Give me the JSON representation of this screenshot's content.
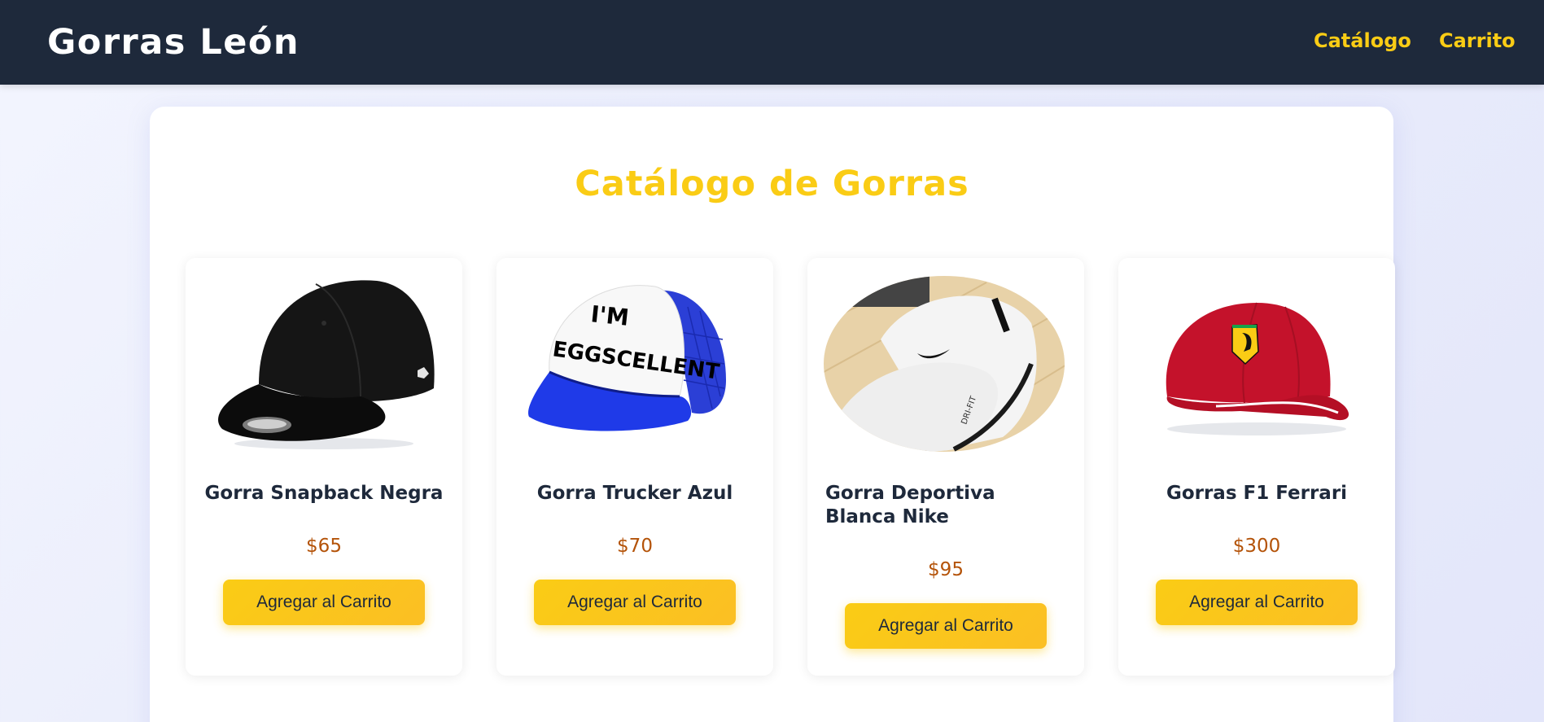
{
  "header": {
    "brand": "Gorras León",
    "nav": [
      {
        "label": "Catálogo"
      },
      {
        "label": "Carrito"
      }
    ]
  },
  "main": {
    "title": "Catálogo de Gorras",
    "products": [
      {
        "name": "Gorra Snapback Negra",
        "price": "$65",
        "button": "Agregar al Carrito",
        "image": "black-snapback-cap"
      },
      {
        "name": "Gorra Trucker Azul",
        "price": "$70",
        "button": "Agregar al Carrito",
        "image": "blue-trucker-cap",
        "image_text": [
          "I'M",
          "EGGSCELLENT"
        ]
      },
      {
        "name": "Gorra Deportiva Blanca Nike",
        "price": "$95",
        "button": "Agregar al Carrito",
        "image": "white-nike-cap"
      },
      {
        "name": "Gorras F1 Ferrari",
        "price": "$300",
        "button": "Agregar al Carrito",
        "image": "red-ferrari-cap"
      }
    ]
  },
  "colors": {
    "header_bg": "#1e293b",
    "accent": "#facc15",
    "price": "#b45309",
    "text": "#1e293b"
  }
}
